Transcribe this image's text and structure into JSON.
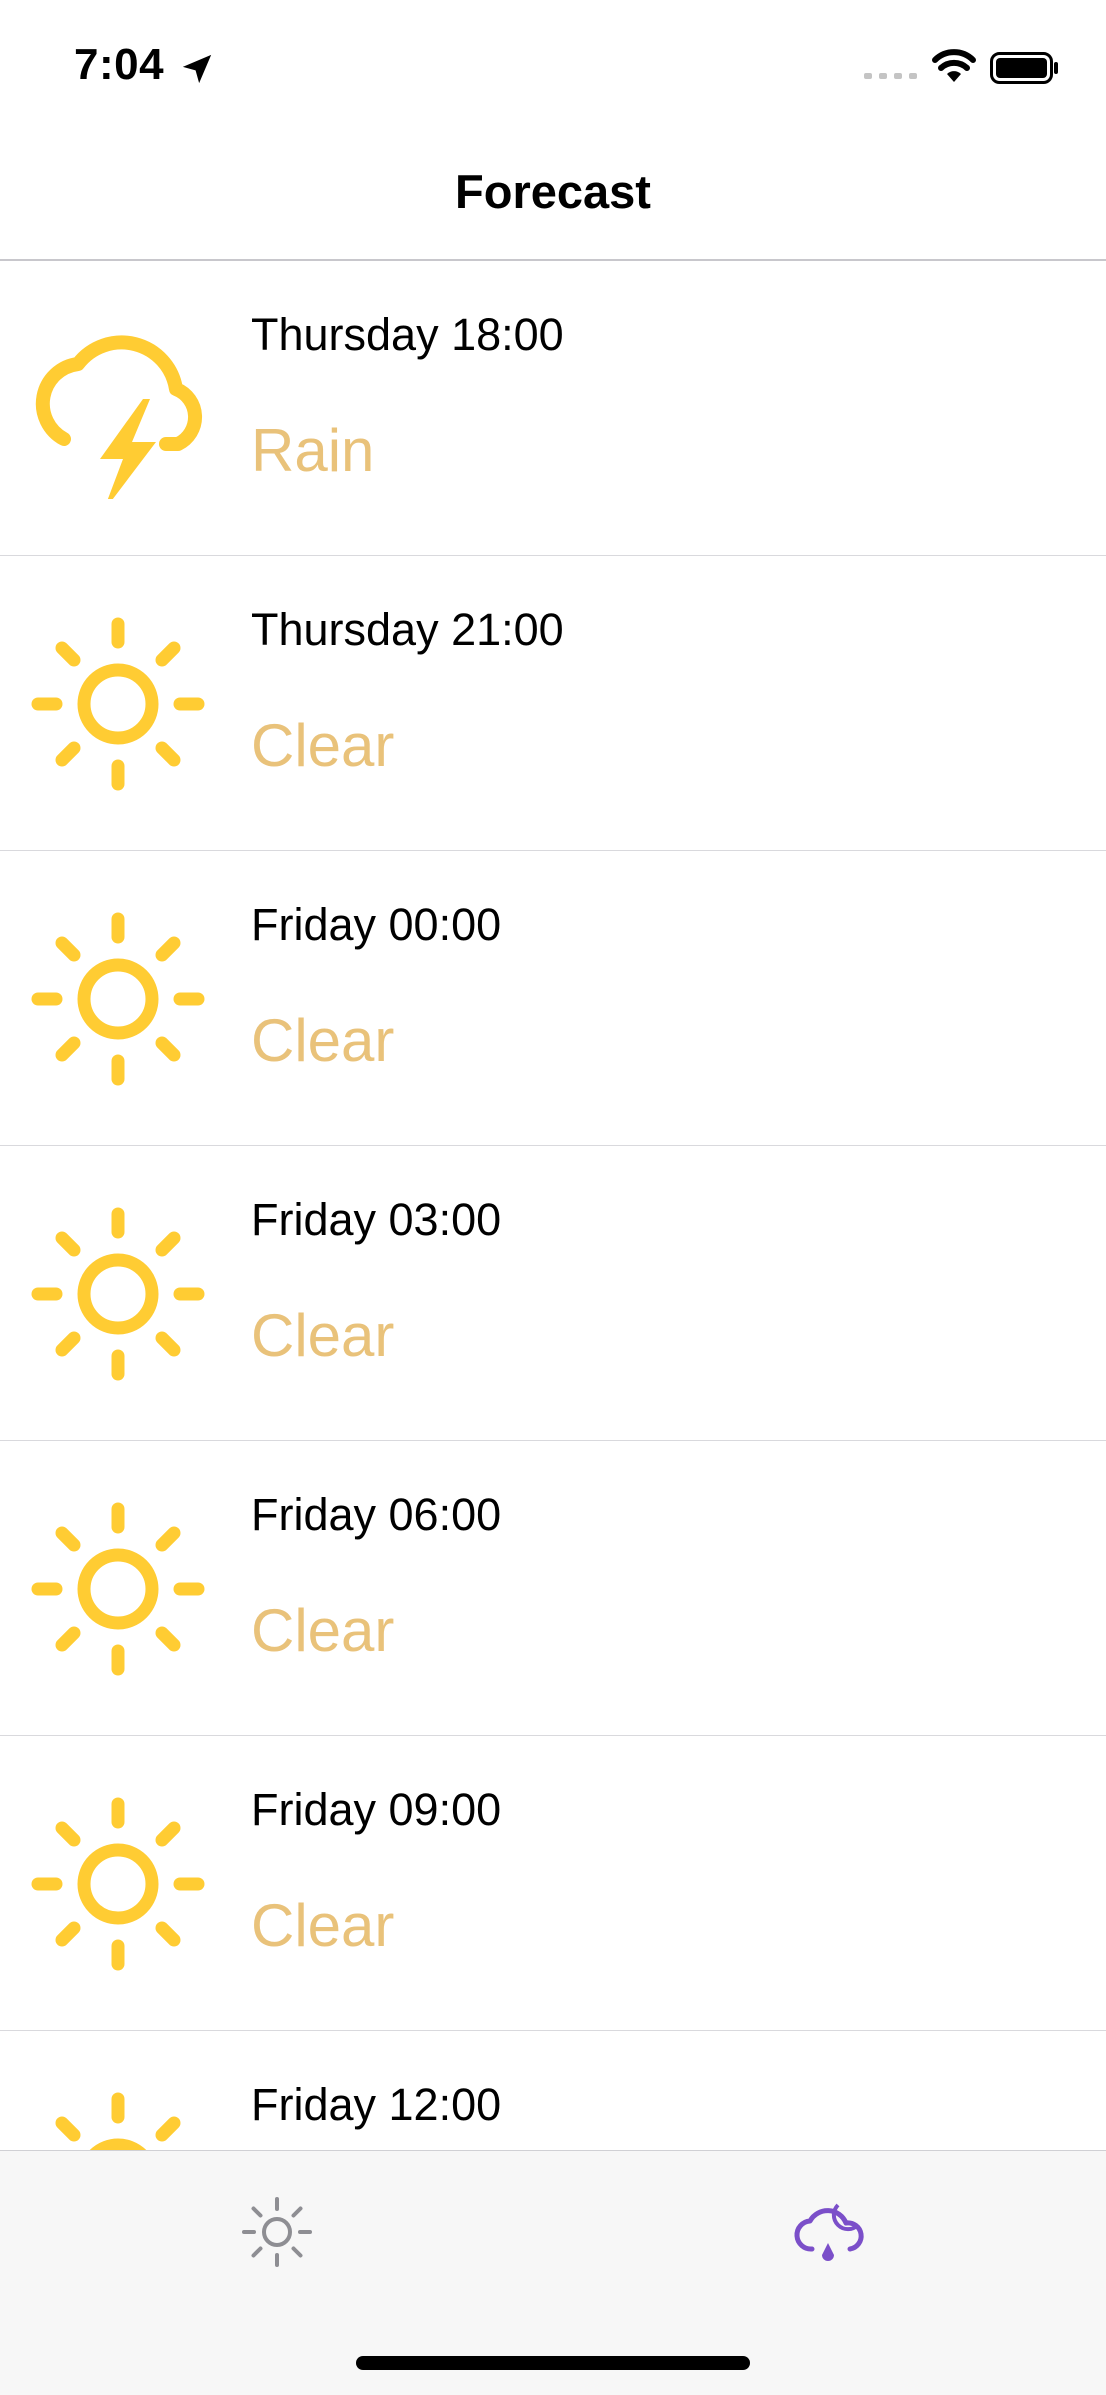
{
  "status_bar": {
    "time": "7:04",
    "location_icon": "location-arrow-icon",
    "signal_icon": "cellular-signal-icon",
    "wifi_icon": "wifi-icon",
    "battery_icon": "battery-icon"
  },
  "nav": {
    "title": "Forecast"
  },
  "colors": {
    "icon_yellow": "#FFCC33",
    "condition_text": "#E9C27A",
    "tab_inactive": "#8E8E93",
    "tab_active": "#7B4FC9"
  },
  "forecast": {
    "items": [
      {
        "time": "Thursday 18:00",
        "condition": "Rain",
        "icon": "thunderstorm-icon"
      },
      {
        "time": "Thursday 21:00",
        "condition": "Clear",
        "icon": "sun-icon"
      },
      {
        "time": "Friday 00:00",
        "condition": "Clear",
        "icon": "sun-icon"
      },
      {
        "time": "Friday 03:00",
        "condition": "Clear",
        "icon": "sun-icon"
      },
      {
        "time": "Friday 06:00",
        "condition": "Clear",
        "icon": "sun-icon"
      },
      {
        "time": "Friday 09:00",
        "condition": "Clear",
        "icon": "sun-icon"
      },
      {
        "time": "Friday 12:00",
        "condition": "",
        "icon": "sun-icon"
      }
    ]
  },
  "tab_bar": {
    "tabs": [
      {
        "icon": "sun-outline-icon",
        "active": false
      },
      {
        "icon": "cloud-moon-rain-icon",
        "active": true
      }
    ]
  }
}
